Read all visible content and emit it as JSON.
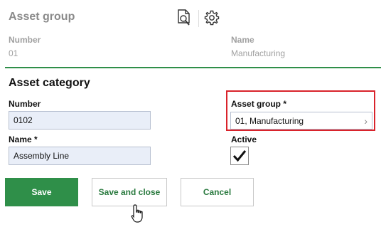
{
  "header": {
    "title": "Asset group",
    "icons": [
      "preview-document-icon",
      "gear-icon"
    ]
  },
  "summary": {
    "number_label": "Number",
    "number_value": "01",
    "name_label": "Name",
    "name_value": "Manufacturing"
  },
  "category": {
    "title": "Asset category",
    "number_label": "Number",
    "number_value": "0102",
    "name_label": "Name *",
    "name_value": "Assembly Line",
    "asset_group_label": "Asset group *",
    "asset_group_value": "01, Manufacturing",
    "active_label": "Active",
    "active_checked": true
  },
  "buttons": {
    "save": "Save",
    "save_and_close": "Save and close",
    "cancel": "Cancel"
  },
  "colors": {
    "accent_green": "#2f8f49",
    "highlight_red": "#d9232b",
    "input_fill": "#e9eef8"
  }
}
